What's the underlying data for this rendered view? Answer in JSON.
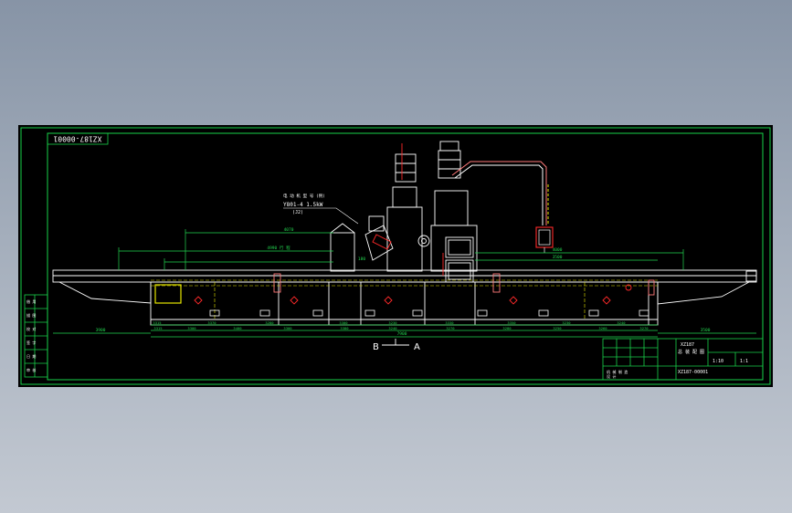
{
  "colors": {
    "frame": "#19d24a",
    "machine": "#ffffff",
    "accent": "#ff2a2a",
    "dim": "#22d64f",
    "dashed": "#e6e600",
    "pink": "#ff7a7a",
    "background": "#000000"
  },
  "drawing": {
    "code": "XZ187-00001",
    "motor_note_line1": "电 动 机 型 号 (例)",
    "motor_note_line2": "Y801-4  1.5kW",
    "motor_note_line3": "(J2)",
    "section_left": "B",
    "section_right": "A"
  },
  "dimensions": {
    "top_1": "4070",
    "top_2": "4000",
    "top_3": "3500",
    "upper_left": "4990 行 程",
    "mid_left": "180",
    "base_left": "3900",
    "base_right": "3500",
    "row1": [
      "3315",
      "3370",
      "3280",
      "3300",
      "3230",
      "3330",
      "3350",
      "3230",
      "3240"
    ],
    "row2": [
      "3315",
      "3300",
      "3400",
      "3300",
      "3380",
      "3240",
      "3270",
      "3280",
      "3250",
      "3260",
      "3270"
    ],
    "overall": "7900"
  },
  "title_block": {
    "name_line1": "XZ187",
    "name_line2": "总 装 配 图",
    "drawing_no": "XZ187-00001",
    "scale": "1:10",
    "sheet": "1:1",
    "company_line1": "机 械 制 造",
    "company_line2": "设 计"
  },
  "sidebar": {
    "labels": [
      "借 用",
      "描 图",
      "校 对",
      "签 字",
      "日 期",
      "审 核"
    ]
  }
}
